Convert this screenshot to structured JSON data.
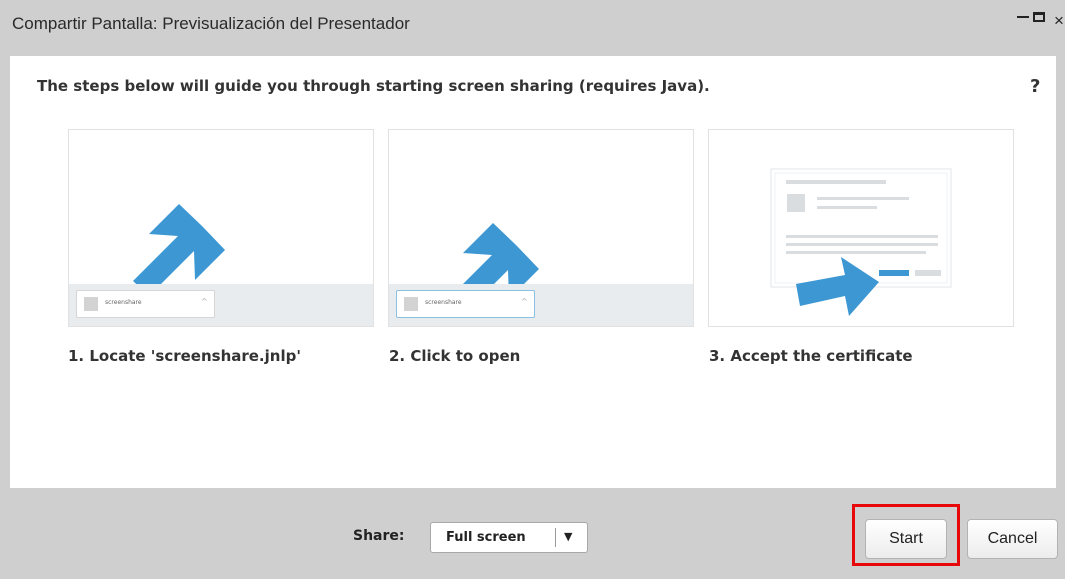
{
  "window": {
    "title": "Compartir Pantalla: Previsualización del Presentador",
    "controls": {
      "minimize": "_",
      "maximize": "□",
      "close": "×"
    }
  },
  "intro_text": "The steps below will guide you through starting screen sharing (requires Java).",
  "help_label": "?",
  "steps": [
    {
      "caption": "1. Locate 'screenshare.jnlp'",
      "download_name": "screenshare"
    },
    {
      "caption": "2. Click to open",
      "download_name": "screenshare"
    },
    {
      "caption": "3. Accept the certificate"
    }
  ],
  "footer": {
    "share_label": "Share:",
    "share_value": "Full screen",
    "start_label": "Start",
    "cancel_label": "Cancel"
  },
  "colors": {
    "arrow": "#3d97d3",
    "highlight": "#e8080a",
    "chrome": "#cfcfcf"
  },
  "icons": [
    "minimize-icon",
    "maximize-icon",
    "close-icon",
    "help-icon",
    "arrow-down-left-icon",
    "arrow-right-icon",
    "file-icon",
    "chevron-up-icon",
    "dropdown-caret-icon"
  ]
}
